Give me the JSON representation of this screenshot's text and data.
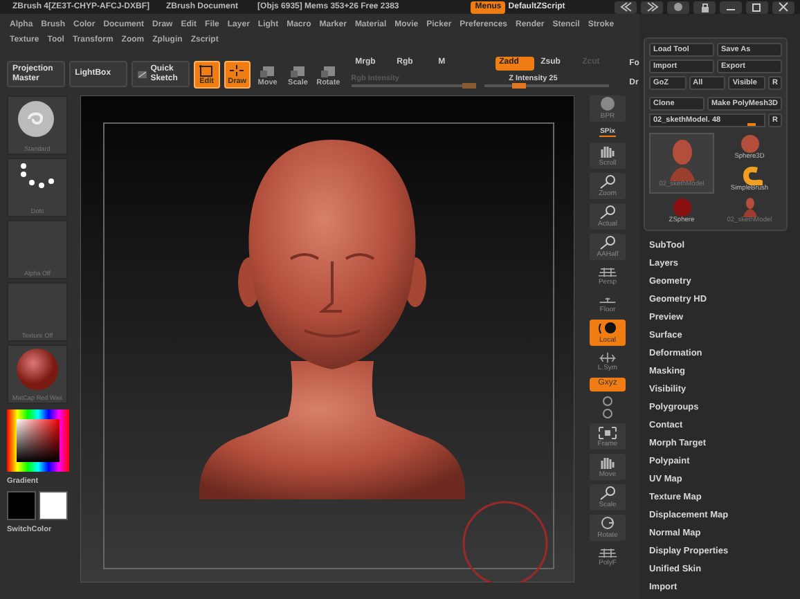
{
  "title_bar": {
    "texts": [
      "ZBrush 4[ZE3T-CHYP-AFCJ-DXBF]",
      "ZBrush Document",
      "[Objs 6935] Mems 353+26 Free 2383"
    ],
    "menus": {
      "label": "Menus",
      "on": true
    },
    "script": "DefaultZScript"
  },
  "menu_bar": {
    "rows": [
      [
        "Alpha",
        "Brush",
        "Color",
        "Document",
        "Draw",
        "Edit",
        "File",
        "Layer",
        "Light",
        "Macro",
        "Marker",
        "Material",
        "Movie",
        "Picker",
        "Preferences",
        "Render",
        "Stencil",
        "Stroke"
      ],
      [
        "Texture",
        "Tool",
        "Transform",
        "Zoom",
        "Zplugin",
        "Zscript"
      ]
    ]
  },
  "toolbar": {
    "items": [
      {
        "kind": "large",
        "label": "Projection Master",
        "on": false
      },
      {
        "kind": "large",
        "label": "LightBox",
        "on": false
      },
      {
        "kind": "sketch",
        "label": "Quick Sketch",
        "on": false
      },
      {
        "kind": "mode",
        "label": "Edit",
        "on": true
      },
      {
        "kind": "mode",
        "label": "Draw",
        "on": true
      },
      {
        "kind": "mode",
        "label": "Move",
        "on": false
      },
      {
        "kind": "mode",
        "label": "Scale",
        "on": false
      },
      {
        "kind": "mode",
        "label": "Rotate",
        "on": false
      }
    ],
    "channels": [
      {
        "label": "Mrgb",
        "on": false,
        "disabled": false
      },
      {
        "label": "Rgb",
        "on": false,
        "disabled": false
      },
      {
        "label": "M",
        "on": false,
        "disabled": false
      },
      {
        "label": "Zadd",
        "on": true,
        "disabled": false
      },
      {
        "label": "Zsub",
        "on": false,
        "disabled": false
      },
      {
        "label": "Zcut",
        "on": false,
        "disabled": true
      }
    ],
    "sliders": [
      {
        "label": "Rgb Intensity",
        "level": 1,
        "disabled": true
      },
      {
        "label": "Z Intensity 25",
        "level": 0.25,
        "disabled": false
      }
    ],
    "cut_off": [
      "Fo",
      "Dr"
    ]
  },
  "left_shelf": {
    "tiles": [
      {
        "kind": "brush",
        "label": "Standard"
      },
      {
        "kind": "stroke",
        "label": "Dots"
      },
      {
        "kind": "empty",
        "label": "Alpha  Off"
      },
      {
        "kind": "empty",
        "label": "Texture  Off"
      },
      {
        "kind": "material",
        "label": "MatCap Red Wax"
      }
    ],
    "color_label": "Gradient",
    "switch_label": "SwitchColor"
  },
  "right_shelf": {
    "items": [
      {
        "kind": "tile",
        "label": "BPR",
        "on": false
      },
      {
        "kind": "indicator",
        "label": "SPix",
        "on": false
      },
      {
        "kind": "tile",
        "label": "Scroll",
        "on": false
      },
      {
        "kind": "tile",
        "label": "Zoom",
        "on": false
      },
      {
        "kind": "tile",
        "label": "Actual",
        "on": false
      },
      {
        "kind": "tile",
        "label": "AAHalf",
        "on": false
      },
      {
        "kind": "plain",
        "label": "Persp",
        "on": false
      },
      {
        "kind": "plain",
        "label": "Floor",
        "on": false
      },
      {
        "kind": "tile",
        "label": "Local",
        "on": true
      },
      {
        "kind": "plain",
        "label": "L.Sym",
        "on": false
      },
      {
        "kind": "pill",
        "label": "Gxyz",
        "on": true
      },
      {
        "kind": "axes",
        "on": false
      },
      {
        "kind": "tile",
        "label": "Frame",
        "on": false
      },
      {
        "kind": "tile",
        "label": "Move",
        "on": false
      },
      {
        "kind": "tile",
        "label": "Scale",
        "on": false
      },
      {
        "kind": "tile",
        "label": "Rotate",
        "on": false
      },
      {
        "kind": "plain",
        "label": "PolyF",
        "on": false
      }
    ]
  },
  "tray": {
    "button_rows": [
      [
        "Load Tool",
        "Save As"
      ],
      [
        "Import",
        "Export"
      ],
      [
        "GoZ",
        "All",
        "Visible",
        "R"
      ],
      [
        "Clone",
        "Make PolyMesh3D"
      ]
    ],
    "slider": {
      "label": "02_skethModel. 48",
      "level": 0.92,
      "button": "R"
    },
    "tools": [
      {
        "kind": "sphere",
        "label": "Sphere3D",
        "selected": false
      },
      {
        "kind": "head",
        "label": "02_skethModel",
        "selected": true
      },
      {
        "kind": "brush",
        "label": "SimpleBrush",
        "selected": false
      },
      {
        "kind": "zsphere",
        "label": "ZSphere",
        "selected": false
      },
      {
        "kind": "head",
        "label": "02_skethModel",
        "selected": false
      }
    ],
    "menu": [
      "SubTool",
      "Layers",
      "Geometry",
      "Geometry HD",
      "Preview",
      "Surface",
      "Deformation",
      "Masking",
      "Visibility",
      "Polygroups",
      "Contact",
      "Morph Target",
      "Polypaint",
      "UV Map",
      "Texture Map",
      "Displacement Map",
      "Normal Map",
      "Display Properties",
      "Unified Skin",
      "Import"
    ]
  }
}
